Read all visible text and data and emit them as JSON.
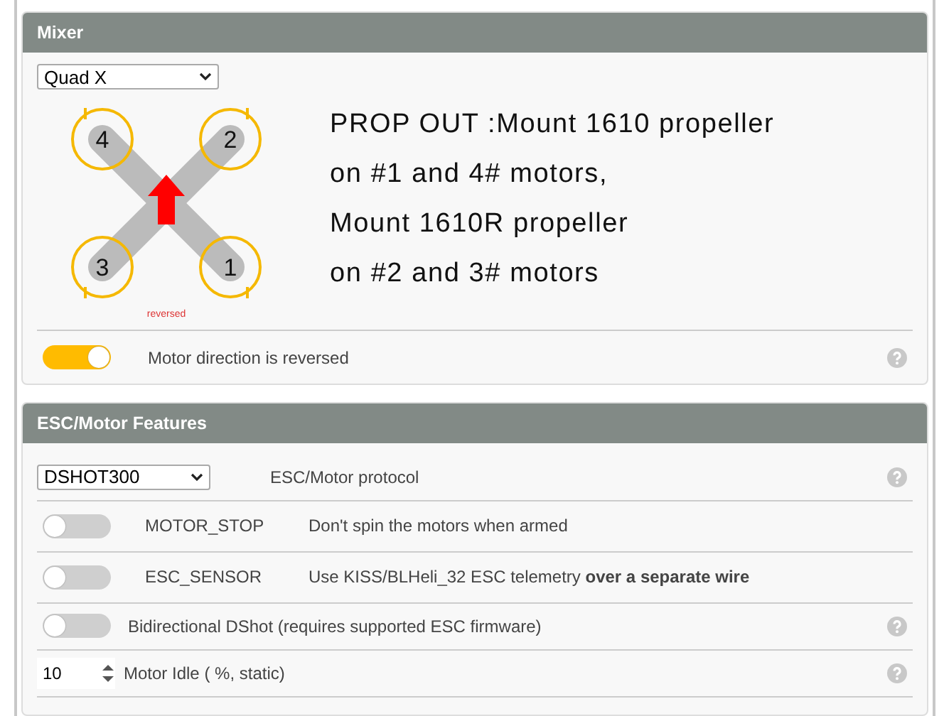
{
  "mixer": {
    "title": "Mixer",
    "select": "Quad X",
    "motors": [
      {
        "label": "4"
      },
      {
        "label": "2"
      },
      {
        "label": "3"
      },
      {
        "label": "1"
      }
    ],
    "diagram_note": "reversed",
    "note_lines": [
      "PROP OUT :Mount 1610 propeller",
      "on #1 and 4# motors,",
      "Mount 1610R propeller",
      "on #2 and 3# motors"
    ],
    "reversed_toggle": {
      "label": "Motor direction is reversed",
      "on": true,
      "help": true
    }
  },
  "esc": {
    "title": "ESC/Motor Features",
    "rows": [
      {
        "kind": "select",
        "value": "DSHOT300",
        "label": "ESC/Motor protocol",
        "help": true
      },
      {
        "kind": "feature",
        "on": false,
        "name": "MOTOR_STOP",
        "label": "Don't spin the motors when armed",
        "help": false
      },
      {
        "kind": "feature",
        "on": false,
        "name": "ESC_SENSOR",
        "label": "Use KISS/BLHeli_32 ESC telemetry **over a separate wire**",
        "help": false
      },
      {
        "kind": "toggle",
        "on": false,
        "label": "Bidirectional DShot (requires supported ESC firmware)",
        "help": true
      },
      {
        "kind": "number",
        "value": "10",
        "label": "Motor Idle ( %, static)",
        "help": true
      }
    ]
  }
}
